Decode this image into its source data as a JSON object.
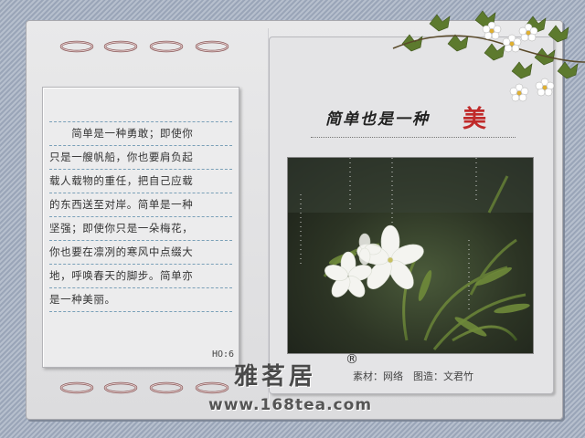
{
  "poem": {
    "lines": [
      "　　简单是一种勇敢；即使你",
      "只是一艘帆船，你也要肩负起",
      "载人载物的重任，把自己应载",
      "的东西送至对岸。简单是一种",
      "坚强；即使你只是一朵梅花，",
      "你也要在凛冽的寒风中点缀大",
      "地，呼唤春天的脚步。简单亦",
      "是一种美丽。"
    ],
    "page_number": "HO:6"
  },
  "title": {
    "main": "简单也是一种",
    "accent": "美",
    "accent_color": "#c02a2a"
  },
  "brand": {
    "name": "雅茗居",
    "registered": "®",
    "credit": "素材：网络　图造：文君竹",
    "url": "www.168tea.com"
  },
  "icons": {
    "rings": "binder-ring-icon",
    "corner": "ivy-flower-decoration",
    "photo": "white-flower-photo"
  }
}
